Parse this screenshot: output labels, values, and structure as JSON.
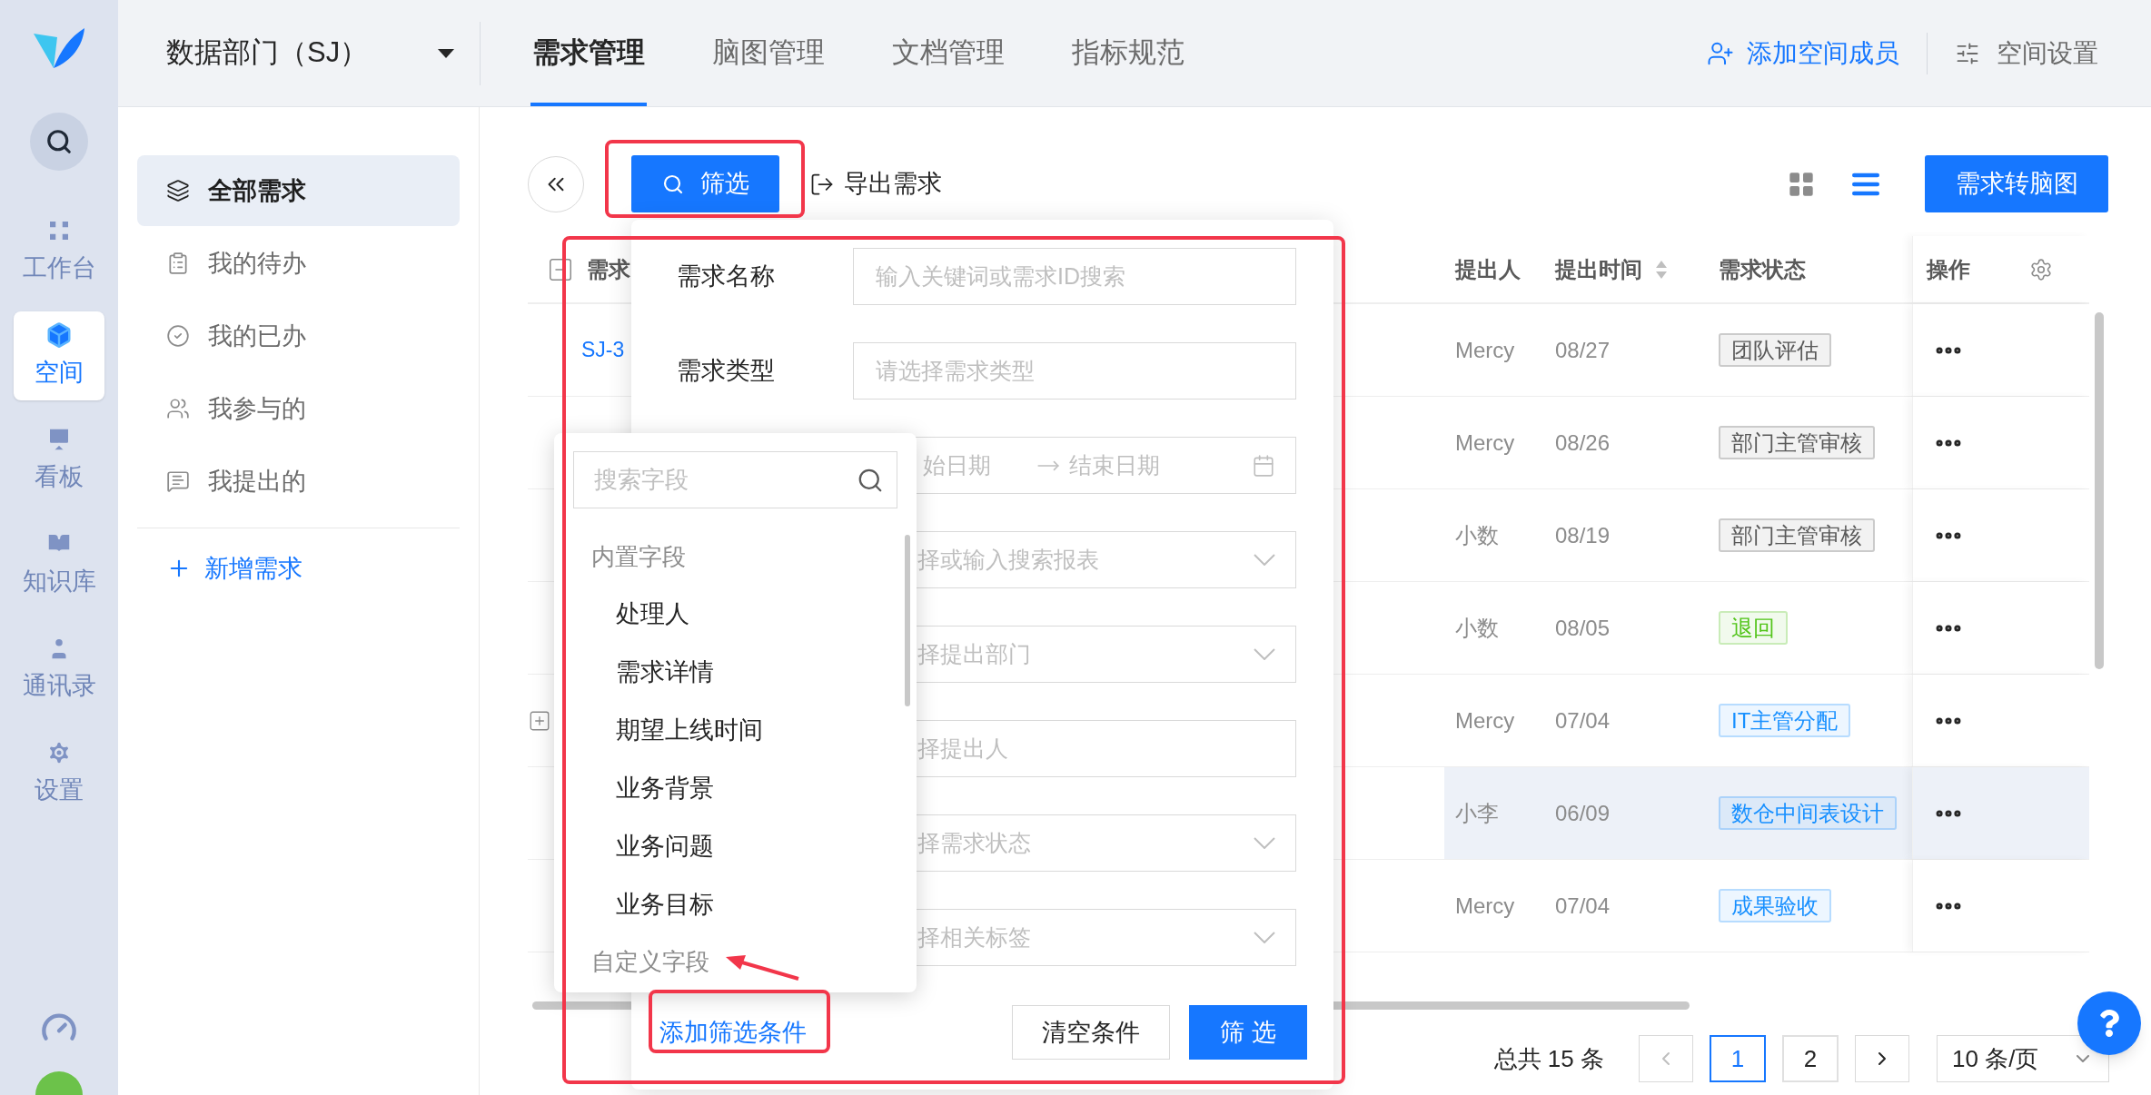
{
  "rail": {
    "items": [
      {
        "label": "工作台",
        "selected": false
      },
      {
        "label": "空间",
        "selected": true
      },
      {
        "label": "看板",
        "selected": false
      },
      {
        "label": "知识库",
        "selected": false
      },
      {
        "label": "通讯录",
        "selected": false
      },
      {
        "label": "设置",
        "selected": false
      }
    ]
  },
  "top_bar": {
    "space_selector": "数据部门（SJ）",
    "tabs": [
      {
        "label": "需求管理",
        "selected": true
      },
      {
        "label": "脑图管理",
        "selected": false
      },
      {
        "label": "文档管理",
        "selected": false
      },
      {
        "label": "指标规范",
        "selected": false
      }
    ],
    "add_member": "添加空间成员",
    "space_settings": "空间设置"
  },
  "sidebar": {
    "items": [
      {
        "label": "全部需求",
        "selected": true
      },
      {
        "label": "我的待办",
        "selected": false
      },
      {
        "label": "我的已办",
        "selected": false
      },
      {
        "label": "我参与的",
        "selected": false
      },
      {
        "label": "我提出的",
        "selected": false
      }
    ],
    "new_button": "新增需求"
  },
  "toolbar": {
    "filter_button": "筛选",
    "export_button": "导出需求",
    "views": [
      {
        "kind": "grid",
        "selected": false
      },
      {
        "kind": "list",
        "selected": true
      }
    ],
    "mindmap_button": "需求转脑图"
  },
  "table": {
    "columns": [
      {
        "label": "需求",
        "sortable": false
      },
      {
        "label": "提出人",
        "sortable": false
      },
      {
        "label": "提出时间",
        "sortable": true
      },
      {
        "label": "需求状态",
        "sortable": false
      },
      {
        "label": "操作",
        "sortable": false
      }
    ],
    "rows": [
      {
        "id": "SJ-3",
        "expandable": false,
        "proposer": "Mercy",
        "date": "08/27",
        "status": {
          "label": "团队评估",
          "color": "#595959"
        },
        "highlighted": false
      },
      {
        "expandable": false,
        "proposer": "Mercy",
        "date": "08/26",
        "status": {
          "label": "部门主管审核",
          "color": "#595959"
        },
        "highlighted": false
      },
      {
        "expandable": false,
        "proposer": "小数",
        "date": "08/19",
        "status": {
          "label": "部门主管审核",
          "color": "#595959"
        },
        "highlighted": false
      },
      {
        "expandable": false,
        "proposer": "小数",
        "date": "08/05",
        "status": {
          "label": "退回",
          "color": "#52c41a"
        },
        "highlighted": false
      },
      {
        "expandable": true,
        "proposer": "Mercy",
        "date": "07/04",
        "status": {
          "label": "IT主管分配",
          "color": "#1890ff"
        },
        "highlighted": false
      },
      {
        "expandable": false,
        "proposer": "小李",
        "date": "06/09",
        "status": {
          "label": "数仓中间表设计",
          "color": "#1890ff"
        },
        "highlighted": true
      },
      {
        "expandable": false,
        "proposer": "Mercy",
        "date": "07/04",
        "status": {
          "label": "成果验收",
          "color": "#1890ff"
        },
        "highlighted": false
      }
    ]
  },
  "pagination": {
    "total": "总共 15 条",
    "pages": [
      {
        "label": "1",
        "selected": true
      },
      {
        "label": "2",
        "selected": false
      }
    ],
    "page_size": "10 条/页"
  },
  "filter_panel": {
    "fields": [
      {
        "kind": "text",
        "label": "需求名称",
        "placeholder": "输入关键词或需求ID搜索"
      },
      {
        "kind": "text",
        "label": "需求类型",
        "placeholder": "请选择需求类型"
      },
      {
        "kind": "date_range",
        "start_placeholder": "始日期",
        "end_placeholder": "结束日期"
      },
      {
        "kind": "select",
        "placeholder": "择或输入搜索报表"
      },
      {
        "kind": "select",
        "placeholder": "择提出部门"
      },
      {
        "kind": "text",
        "placeholder": "择提出人"
      },
      {
        "kind": "select",
        "placeholder": "择需求状态"
      },
      {
        "kind": "select",
        "placeholder": "择相关标签"
      }
    ],
    "add_condition": "添加筛选条件",
    "clear_button": "清空条件",
    "apply_button": "筛 选"
  },
  "field_dropdown": {
    "search_placeholder": "搜索字段",
    "groups": [
      {
        "label": "内置字段",
        "items": [
          "处理人",
          "需求详情",
          "期望上线时间",
          "业务背景",
          "业务问题",
          "业务目标"
        ]
      },
      {
        "label": "自定义字段"
      }
    ]
  }
}
